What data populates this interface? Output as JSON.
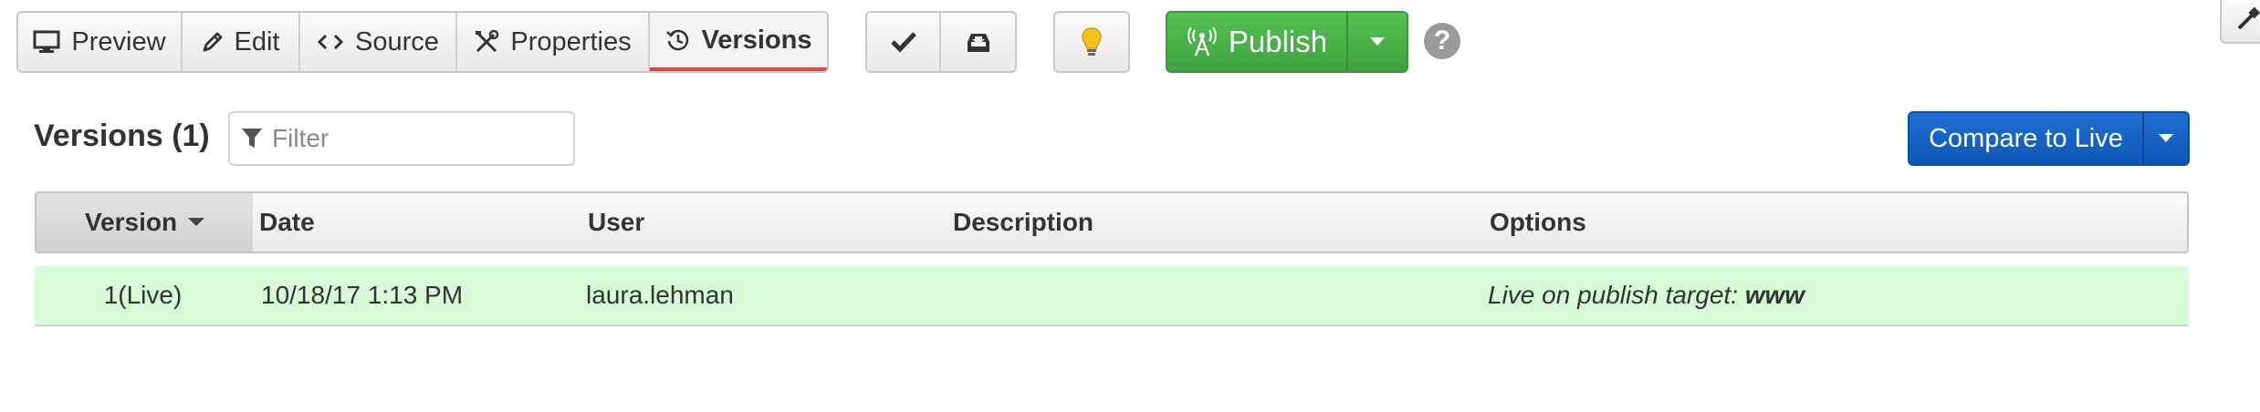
{
  "toolbar": {
    "tabs": [
      {
        "label": "Preview",
        "icon": "monitor-icon"
      },
      {
        "label": "Edit",
        "icon": "pencil-icon"
      },
      {
        "label": "Source",
        "icon": "code-icon"
      },
      {
        "label": "Properties",
        "icon": "tools-icon"
      },
      {
        "label": "Versions",
        "icon": "history-icon",
        "active": true
      }
    ],
    "tools": [
      {
        "icon": "checkmark-icon"
      },
      {
        "icon": "archive-download-icon"
      }
    ],
    "tip_icon": "lightbulb-icon",
    "publish_label": "Publish",
    "publish_icon": "broadcast-tower-icon",
    "help_label": "?",
    "accent_red": "#e0443a",
    "publish_green": "#4bb34b",
    "primary_blue": "#1663c4"
  },
  "header": {
    "title": "Versions (1)",
    "filter_placeholder": "Filter",
    "compare_label": "Compare to Live"
  },
  "table": {
    "columns": [
      "Version",
      "Date",
      "User",
      "Description",
      "Options"
    ],
    "sort_column": "Version",
    "rows": [
      {
        "version": "1(Live)",
        "date": "10/18/17 1:13 PM",
        "user": "laura.lehman",
        "description": "",
        "options_prefix": "Live on publish target: ",
        "options_target": "www",
        "row_color": "#d6fbd6"
      }
    ]
  }
}
